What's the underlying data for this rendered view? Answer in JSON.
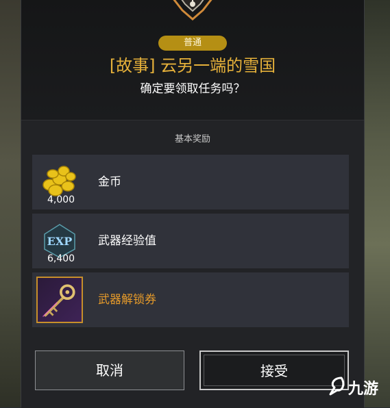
{
  "dialog": {
    "badge": "普通",
    "title": "[故事] 云另一端的雪国",
    "subtitle": "确定要领取任务吗？",
    "section_label": "基本奖励"
  },
  "rewards": [
    {
      "name": "金币",
      "count": "4,000",
      "icon": "gold-coins-icon"
    },
    {
      "name": "武器经验值",
      "count": "6,400",
      "icon": "exp-icon",
      "icon_text": "EXP"
    },
    {
      "name": "武器解锁券",
      "count": "",
      "icon": "golden-key-icon"
    }
  ],
  "buttons": {
    "cancel": "取消",
    "accept": "接受"
  },
  "watermark": {
    "text": "九游"
  },
  "colors": {
    "accent_gold": "#e6b13a",
    "badge": "#b58f14",
    "special_item": "#e59a2a"
  }
}
